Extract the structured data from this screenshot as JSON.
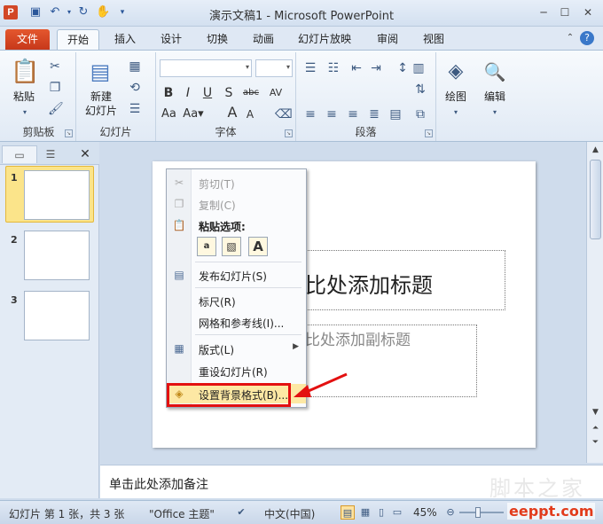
{
  "window": {
    "title": "演示文稿1 - Microsoft PowerPoint",
    "app_logo": "P"
  },
  "quick_access": [
    "save-icon",
    "undo-icon",
    "redo-icon",
    "customize-icon"
  ],
  "tabs": {
    "file": "文件",
    "items": [
      "开始",
      "插入",
      "设计",
      "切换",
      "动画",
      "幻灯片放映",
      "审阅",
      "视图"
    ],
    "active": "开始"
  },
  "ribbon": {
    "clipboard": {
      "paste": "粘贴",
      "label": "剪贴板"
    },
    "slides": {
      "new_slide_line1": "新建",
      "new_slide_line2": "幻灯片",
      "label": "幻灯片"
    },
    "font": {
      "bold": "B",
      "italic": "I",
      "underline": "U",
      "shadow": "S",
      "strike": "abc",
      "spacing": "AV",
      "case": "Aa",
      "grow": "A",
      "shrink": "A",
      "label": "字体"
    },
    "paragraph": {
      "label": "段落"
    },
    "drawing": {
      "label": "绘图"
    },
    "editing": {
      "label": "编辑"
    }
  },
  "slides_pane": {
    "thumbnails": [
      "1",
      "2",
      "3"
    ],
    "selected": "1"
  },
  "slide": {
    "title_placeholder": "比处添加标题",
    "subtitle_placeholder": "比处添加副标题"
  },
  "context_menu": {
    "cut": "剪切(T)",
    "copy": "复制(C)",
    "paste_options": "粘贴选项:",
    "paste_buttons": [
      "a",
      "",
      "A"
    ],
    "publish": "发布幻灯片(S)",
    "ruler": "标尺(R)",
    "grid": "网格和参考线(I)...",
    "layout": "版式(L)",
    "reset": "重设幻灯片(R)",
    "format_background": "设置背景格式(B)..."
  },
  "notes": {
    "placeholder": "单击此处添加备注"
  },
  "status": {
    "slide_info": "幻灯片 第 1 张，共 3 张",
    "theme": "\"Office 主题\"",
    "language": "中文(中国)",
    "zoom": "45%"
  },
  "watermark": {
    "text": "脚本之家",
    "url": "eeppt.com"
  },
  "colors": {
    "file_tab": "#d24726",
    "highlight": "#e31010",
    "accent": "#2b579a"
  }
}
